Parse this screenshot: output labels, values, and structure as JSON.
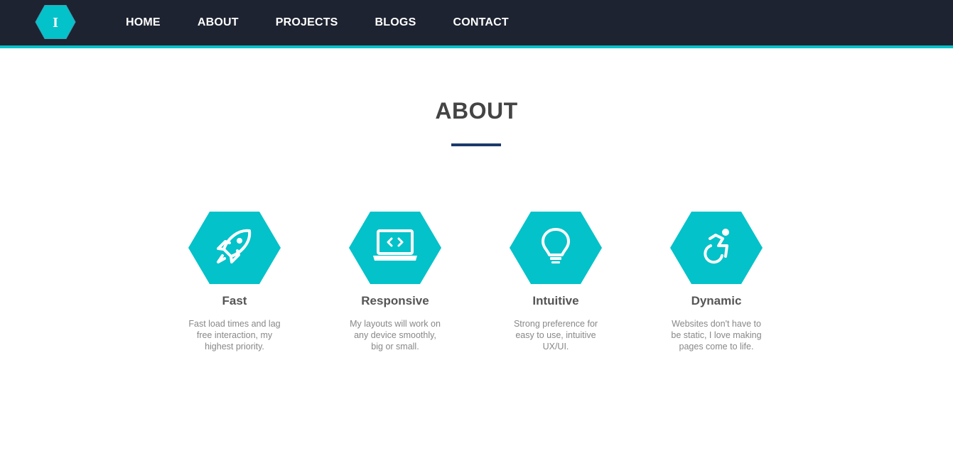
{
  "nav": {
    "logo_letter": "I",
    "links": [
      "HOME",
      "ABOUT",
      "PROJECTS",
      "BLOGS",
      "CONTACT"
    ]
  },
  "about": {
    "title": "ABOUT",
    "features": [
      {
        "icon": "rocket-icon",
        "label": "Fast",
        "desc": "Fast load times and lag free interaction, my highest priority."
      },
      {
        "icon": "laptop-code-icon",
        "label": "Responsive",
        "desc": "My layouts will work on any device smoothly, big or small."
      },
      {
        "icon": "lightbulb-icon",
        "label": "Intuitive",
        "desc": "Strong preference for easy to use, intuitive UX/UI."
      },
      {
        "icon": "accessible-icon",
        "label": "Dynamic",
        "desc": "Websites don't have to be static, I love making pages come to life."
      }
    ]
  },
  "colors": {
    "accent": "#04c2c9",
    "navbar": "#1e2331",
    "title_bar": "#1b3a6b"
  }
}
